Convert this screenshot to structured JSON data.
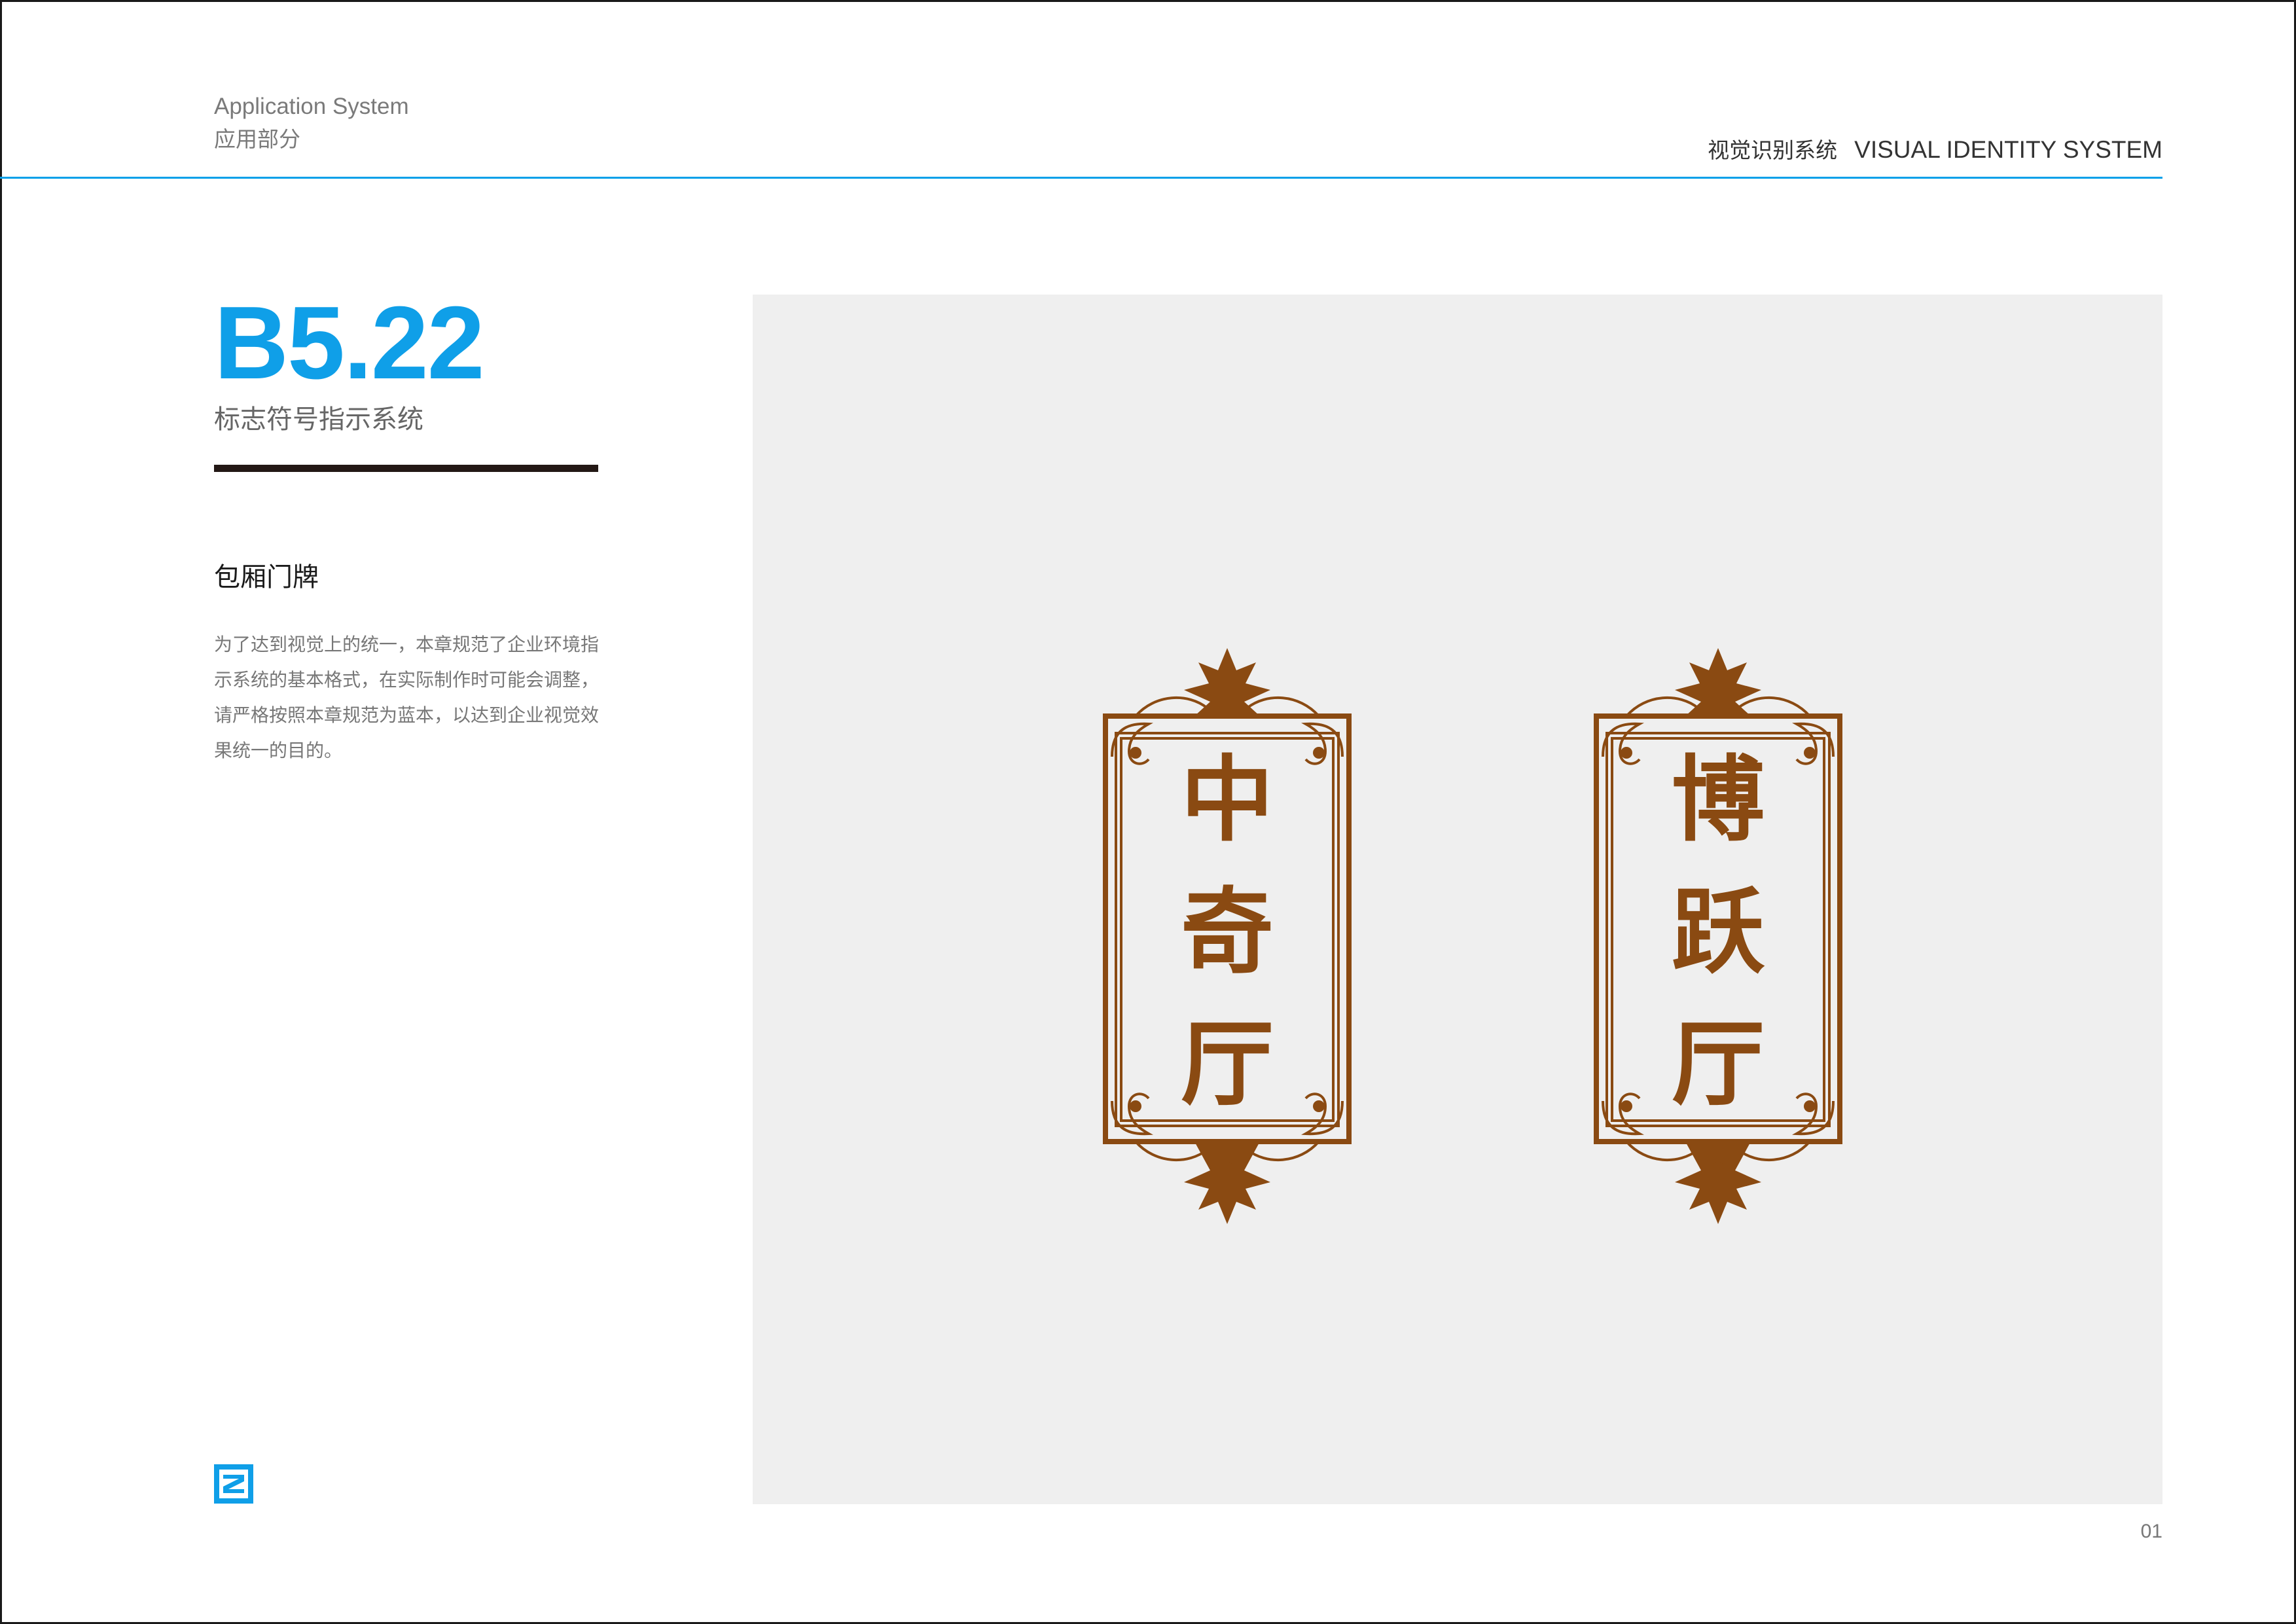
{
  "header": {
    "subtitle_en": "Application System",
    "subtitle_cn": "应用部分",
    "system_cn": "视觉识别系统",
    "system_en": "VISUAL IDENTITY SYSTEM"
  },
  "section": {
    "number": "B5.22",
    "title": "标志符号指示系统"
  },
  "content": {
    "heading": "包厢门牌",
    "body": "为了达到视觉上的统一，本章规范了企业环境指示系统的基本格式，在实际制作时可能会调整，请严格按照本章规范为蓝本，以达到企业视觉效果统一的目的。"
  },
  "plaques": [
    {
      "chars": [
        "中",
        "奇",
        "厅"
      ]
    },
    {
      "chars": [
        "博",
        "跃",
        "厅"
      ]
    }
  ],
  "colors": {
    "accent": "#0f9fe8",
    "rule": "#00a0e9",
    "plaque_brown": "#8a4a12",
    "panel_bg": "#efefef"
  },
  "footer": {
    "page_number": "01"
  }
}
